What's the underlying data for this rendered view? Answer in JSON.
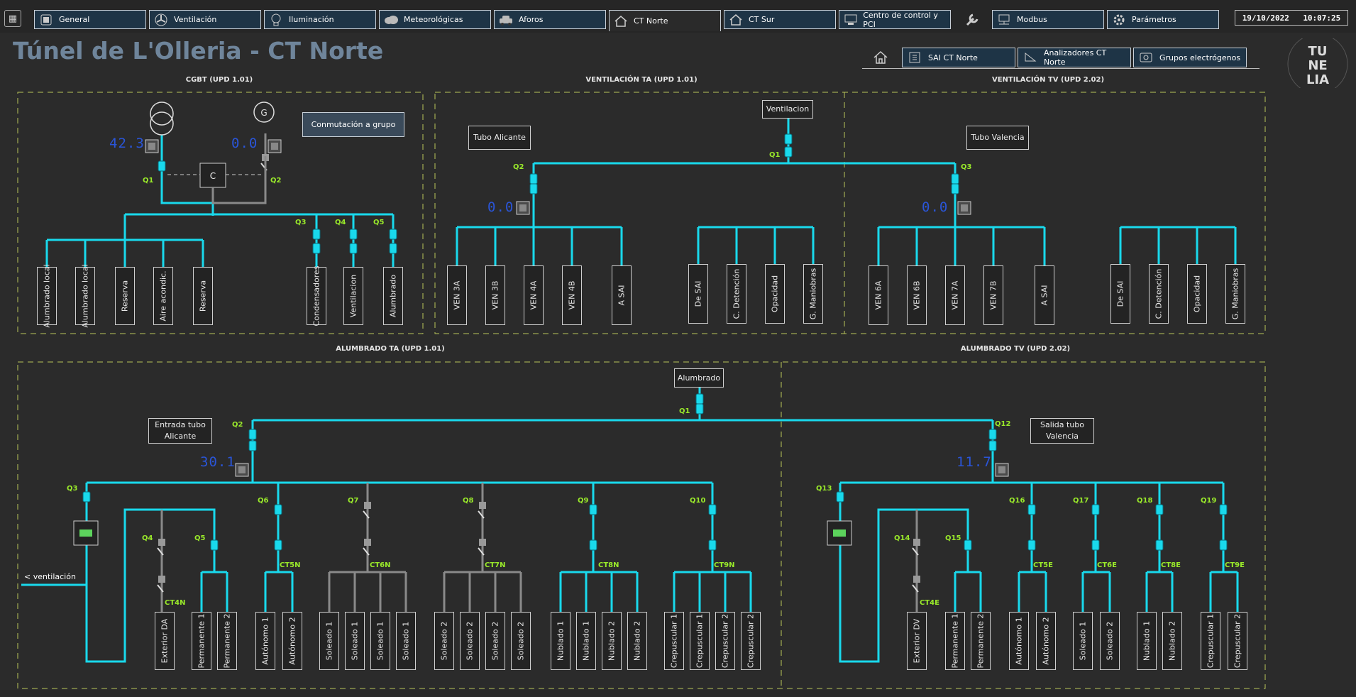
{
  "nav": {
    "tabs": [
      {
        "label": "General",
        "icon": "general-icon"
      },
      {
        "label": "Ventilación",
        "icon": "fan-icon"
      },
      {
        "label": "Iluminación",
        "icon": "bulb-icon"
      },
      {
        "label": "Meteorológicas",
        "icon": "cloud-icon"
      },
      {
        "label": "Aforos",
        "icon": "car-icon"
      },
      {
        "label": "CT Norte",
        "icon": "home-icon",
        "active": true
      },
      {
        "label": "CT Sur",
        "icon": "home-icon"
      },
      {
        "label": "Centro de control y PCI",
        "icon": "computer-icon"
      },
      {
        "label": "Modbus",
        "icon": "network-icon"
      },
      {
        "label": "Parámetros",
        "icon": "gear-icon"
      }
    ],
    "date": "19/10/2022",
    "time": "10:07:25"
  },
  "page": {
    "title": "Túnel de L'Olleria - CT Norte"
  },
  "subnav": {
    "items": [
      {
        "label": "SAI CT Norte",
        "icon": "ups-icon"
      },
      {
        "label": "Analizadores CT Norte",
        "icon": "analyzer-icon"
      },
      {
        "label": "Grupos electrógenos",
        "icon": "generator-icon"
      }
    ]
  },
  "logo": {
    "line1": "TU",
    "line2": "NE",
    "line3": "LIA"
  },
  "sections": {
    "cgbt": "CGBT (UPD 1.01)",
    "vent_ta": "VENTILACIÓN TA (UPD 1.01)",
    "vent_tv": "VENTILACIÓN TV (UPD 2.02)",
    "alum_ta": "ALUMBRADO TA (UPD 1.01)",
    "alum_tv": "ALUMBRADO TV (UPD 2.02)"
  },
  "cgbt": {
    "button": "Conmutación a grupo",
    "coupler": "C",
    "meter1": "42.3",
    "meter2": "0.0",
    "q1": "Q1",
    "q2": "Q2",
    "q3": "Q3",
    "q4": "Q4",
    "q5": "Q5",
    "loads": [
      "Alumbrado local",
      "Alumbrado local",
      "Reserva",
      "Aire acondic.",
      "Reserva",
      "Condensadores",
      "Ventilacion",
      "Alumbrado"
    ]
  },
  "vent": {
    "ventilacion": "Ventilacion",
    "tubo_alicante": "Tubo Alicante",
    "tubo_valencia": "Tubo Valencia",
    "q1": "Q1",
    "q2": "Q2",
    "q3": "Q3",
    "meter_ta": "0.0",
    "meter_tv": "0.0",
    "loads_ta": [
      "VEN 3A",
      "VEN 3B",
      "VEN 4A",
      "VEN 4B",
      "A SAI"
    ],
    "loads_ta2": [
      "De SAI",
      "C. Detención",
      "Opacidad",
      "G. Maniobras"
    ],
    "loads_tv": [
      "VEN 6A",
      "VEN 6B",
      "VEN 7A",
      "VEN 7B",
      "A SAI"
    ],
    "loads_tv2": [
      "De SAI",
      "C. Detención",
      "Opacidad",
      "G. Maniobras"
    ]
  },
  "alum": {
    "alumbrado": "Alumbrado",
    "entrada_l1": "Entrada tubo",
    "entrada_l2": "Alicante",
    "salida_l1": "Salida tubo",
    "salida_l2": "Valencia",
    "meter_ta": "30.1",
    "meter_tv": "11.7",
    "vent_link": "< ventilación",
    "q": {
      "q1": "Q1",
      "q2": "Q2",
      "q12": "Q12",
      "q3": "Q3",
      "q4": "Q4",
      "q5": "Q5",
      "q6": "Q6",
      "q7": "Q7",
      "q8": "Q8",
      "q9": "Q9",
      "q10": "Q10",
      "q13": "Q13",
      "q14": "Q14",
      "q15": "Q15",
      "q16": "Q16",
      "q17": "Q17",
      "q18": "Q18",
      "q19": "Q19"
    },
    "ct": {
      "ct4n": "CT4N",
      "ct5n": "CT5N",
      "ct6n": "CT6N",
      "ct7n": "CT7N",
      "ct8n": "CT8N",
      "ct9n": "CT9N",
      "ct4e": "CT4E",
      "ct5e": "CT5E",
      "ct6e": "CT6E",
      "ct8e": "CT8E",
      "ct9e": "CT9E"
    },
    "loads_ta": [
      "Exterior DA",
      "Permanente 1",
      "Permanente 2",
      "Autónomo 1",
      "Autónomo 2",
      "Soleado 1",
      "Soleado 1",
      "Soleado 1",
      "Soleado 1",
      "Soleado 2",
      "Soleado 2",
      "Soleado 2",
      "Soleado 2",
      "Nublado 1",
      "Nublado 1",
      "Nublado 2",
      "Nublado 2",
      "Crepuscular 1",
      "Crepuscular 1",
      "Crepuscular 2",
      "Crepuscular 2"
    ],
    "loads_tv": [
      "Exterior DV",
      "Permanente 1",
      "Permanente 2",
      "Autónomo 1",
      "Autónomo 2",
      "Soleado 1",
      "Soleado 2",
      "Nublado 1",
      "Nublado 2",
      "Crepuscular 1",
      "Crepuscular 2"
    ]
  },
  "colors": {
    "bus": "#19d9ec",
    "label": "#9aea2a",
    "digits": "#2a55d8",
    "dash": "#b9c55a",
    "gray": "#8a8a8a"
  }
}
